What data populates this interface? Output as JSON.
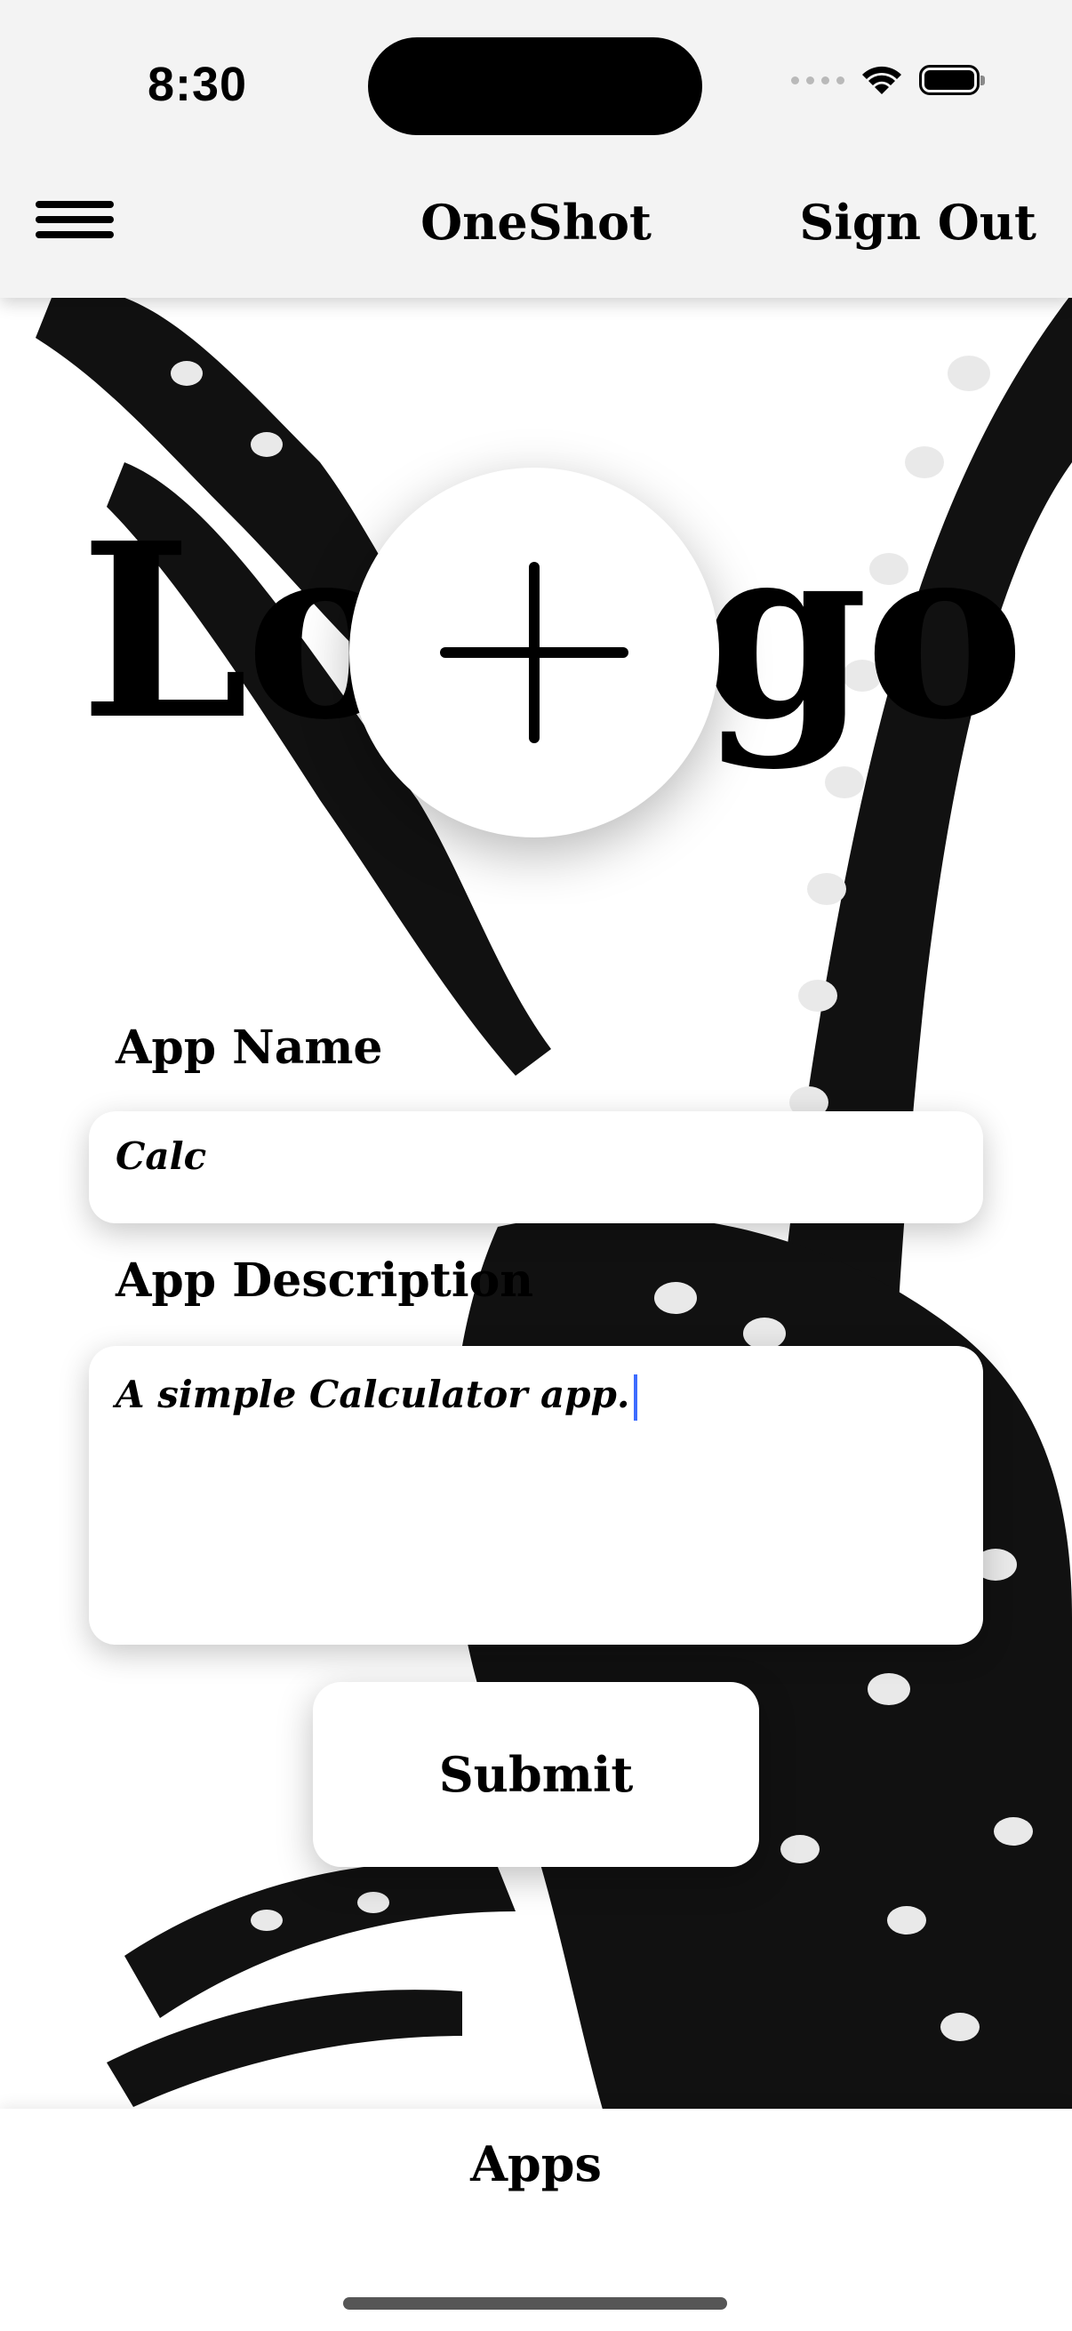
{
  "status_bar": {
    "time": "8:30",
    "icons": [
      "cellular-signal-icon",
      "wifi-icon",
      "battery-icon"
    ]
  },
  "nav": {
    "menu_icon": "hamburger-menu-icon",
    "title": "OneShot",
    "sign_out_label": "Sign Out"
  },
  "logo": {
    "placeholder_text_left": "Lo",
    "placeholder_text_right": "go",
    "add_icon": "plus-icon"
  },
  "form": {
    "app_name_label": "App Name",
    "app_name_value": "Calc",
    "app_description_label": "App Description",
    "app_description_value": "A simple Calculator app.",
    "submit_label": "Submit"
  },
  "tab_bar": {
    "items": [
      {
        "label": "Apps"
      }
    ]
  },
  "colors": {
    "background": "#ffffff",
    "topbar": "#f3f3f3",
    "caret": "#3d6cff",
    "text": "#000000"
  }
}
